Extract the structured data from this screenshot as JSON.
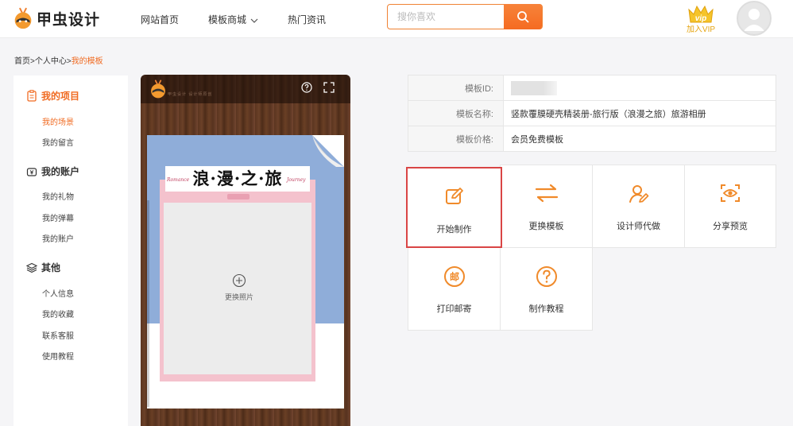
{
  "brand": {
    "name": "甲虫设计",
    "accent": "#f06b22"
  },
  "nav": {
    "home": "网站首页",
    "templates": "模板商城",
    "news": "热门资讯"
  },
  "search": {
    "placeholder": "搜你喜欢",
    "icon": "search-icon"
  },
  "vip": {
    "badge": "vip",
    "label": "加入VIP"
  },
  "breadcrumb": {
    "home": "首页",
    "sep1": ">",
    "center": "个人中心",
    "sep2": ">",
    "current": "我的模板"
  },
  "sidebar": {
    "groups": [
      {
        "label": "我的项目",
        "icon": "document-icon",
        "items": [
          "我的场景",
          "我的留言"
        ]
      },
      {
        "label": "我的账户",
        "icon": "wallet-icon",
        "items": [
          "我的礼物",
          "我的弹幕",
          "我的账户"
        ]
      },
      {
        "label": "其他",
        "icon": "layers-icon",
        "items": [
          "个人信息",
          "我的收藏",
          "联系客服",
          "使用教程"
        ]
      }
    ]
  },
  "preview": {
    "title": "浪·漫·之·旅",
    "sub_left": "Romance",
    "sub_right": "Journey",
    "replace_photo": "更换照片",
    "logo_caption": "甲虫设计 设计师原创"
  },
  "info": {
    "rows": [
      {
        "key": "模板ID:",
        "value": ""
      },
      {
        "key": "模板名称:",
        "value": "竖款覆膜硬壳精装册-旅行版（浪漫之旅）旅游相册"
      },
      {
        "key": "模板价格:",
        "value": "会员免费模板"
      }
    ]
  },
  "actions": [
    {
      "label": "开始制作",
      "icon": "edit-icon"
    },
    {
      "label": "更换模板",
      "icon": "swap-icon"
    },
    {
      "label": "设计师代做",
      "icon": "designer-icon"
    },
    {
      "label": "分享预览",
      "icon": "eye-preview-icon"
    },
    {
      "label": "打印邮寄",
      "icon": "mail-stamp-icon"
    },
    {
      "label": "制作教程",
      "icon": "help-icon"
    }
  ]
}
